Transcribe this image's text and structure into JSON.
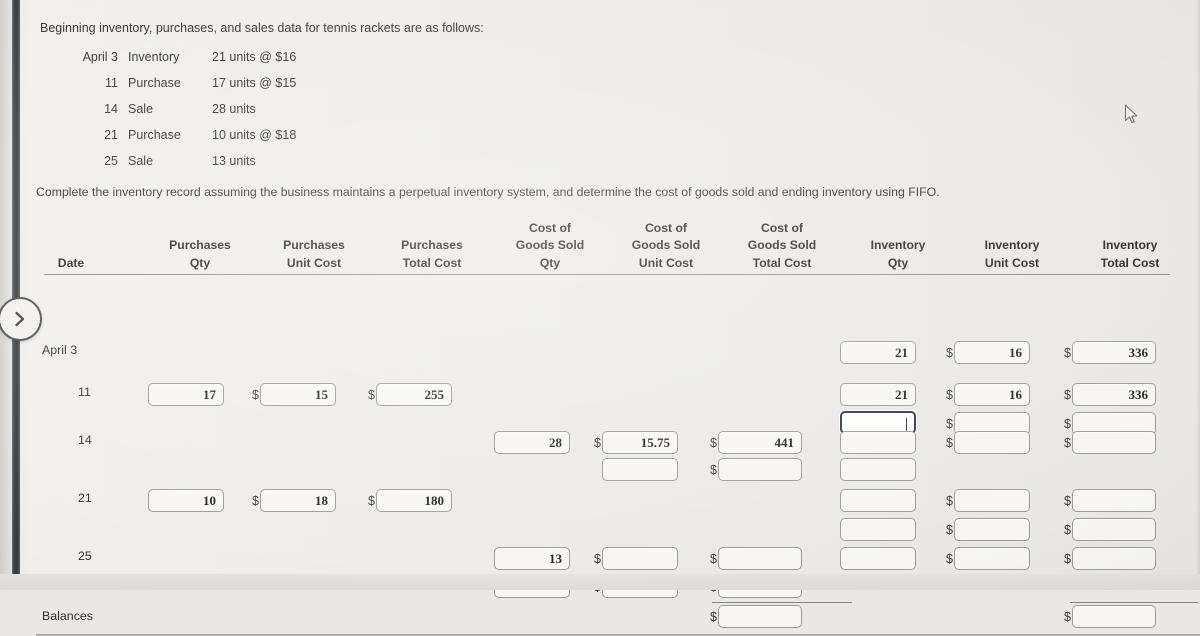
{
  "intro": {
    "text": "Beginning inventory, purchases, and sales data for tennis rackets are as follows:"
  },
  "transactions": [
    {
      "date": "April 3",
      "kind": "Inventory",
      "detail": "21 units @ $16"
    },
    {
      "date": "11",
      "kind": "Purchase",
      "detail": "17 units @ $15"
    },
    {
      "date": "14",
      "kind": "Sale",
      "detail": "28 units"
    },
    {
      "date": "21",
      "kind": "Purchase",
      "detail": "10 units @ $18"
    },
    {
      "date": "25",
      "kind": "Sale",
      "detail": "13 units"
    }
  ],
  "instruction": {
    "text": "Complete the inventory record assuming the business maintains a perpetual inventory system, and determine the cost of goods sold and ending inventory using FIFO."
  },
  "table": {
    "headers": {
      "date": "Date",
      "purchases_qty": "Purchases\nQty",
      "purchases_qty_l1": "Purchases",
      "purchases_qty_l2": "Qty",
      "purchases_unit_l1": "Purchases",
      "purchases_unit_l2": "Unit Cost",
      "purchases_total_l1": "Purchases",
      "purchases_total_l2": "Total Cost",
      "cogs_qty_l1": "Cost of",
      "cogs_qty_l2": "Goods Sold",
      "cogs_qty_l3": "Qty",
      "cogs_unit_l1": "Cost of",
      "cogs_unit_l2": "Goods Sold",
      "cogs_unit_l3": "Unit Cost",
      "cogs_total_l1": "Cost of",
      "cogs_total_l2": "Goods Sold",
      "cogs_total_l3": "Total Cost",
      "inv_qty_l1": "Inventory",
      "inv_qty_l2": "Qty",
      "inv_unit_l1": "Inventory",
      "inv_unit_l2": "Unit Cost",
      "inv_total_l1": "Inventory",
      "inv_total_l2": "Total Cost"
    },
    "row_labels": {
      "april3": "April 3",
      "r11": "11",
      "r14": "14",
      "r21": "21",
      "r25": "25",
      "balances": "Balances"
    },
    "currency_symbol": "$",
    "values": {
      "apr3_inv_qty": "21",
      "apr3_inv_unit": "16",
      "apr3_inv_total": "336",
      "r11_pur_qty": "17",
      "r11_pur_unit": "15",
      "r11_pur_total": "255",
      "r11_inv_qty": "21",
      "r11_inv_unit": "16",
      "r11_inv_total": "336",
      "r11b_inv_qty": "",
      "r11b_inv_unit": "",
      "r11b_inv_total": "",
      "r14_cogs_qty": "28",
      "r14_cogs_unit": "15.75",
      "r14_cogs_total": "441",
      "r14_inv_qty": "",
      "r14_inv_unit": "",
      "r14_inv_total": "",
      "r14b_cogs_unit": "",
      "r14b_cogs_total": "",
      "r14b_inv_qty": "",
      "r21_pur_qty": "10",
      "r21_pur_unit": "18",
      "r21_pur_total": "180",
      "r21_inv_qty": "",
      "r21_inv_unit": "",
      "r21_inv_total": "",
      "r21b_inv_qty": "",
      "r21b_inv_unit": "",
      "r21b_inv_total": "",
      "r25_cogs_qty": "13",
      "r25_cogs_unit": "",
      "r25_cogs_total": "",
      "r25_inv_qty": "",
      "r25_inv_unit": "",
      "r25_inv_total": "",
      "r25b_cogs_qty": "",
      "r25b_cogs_unit": "",
      "r25b_cogs_total": "",
      "bal_cogs_total": "",
      "bal_inv_total": ""
    }
  },
  "icons": {
    "next_arrow": "chevron-right-icon",
    "pointer": "mouse-pointer-icon"
  },
  "colors": {
    "focus_border": "#2b3346",
    "field_border": "#9a9a98",
    "rail": "#323639",
    "text": "#2e2e2e"
  }
}
